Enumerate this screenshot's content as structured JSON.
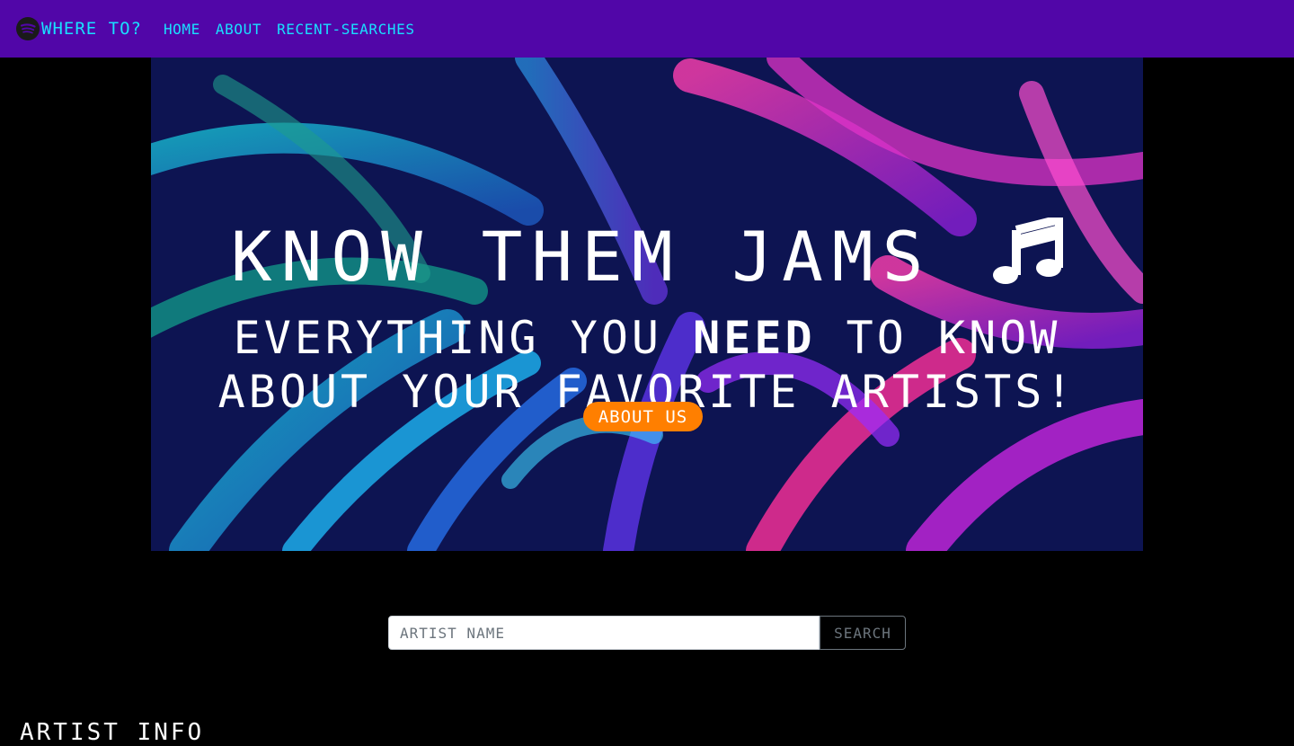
{
  "nav": {
    "brand": "WHERE TO?",
    "links": [
      "HOME",
      "ABOUT",
      "RECENT-SEARCHES"
    ]
  },
  "hero": {
    "title": "KNOW THEM JAMS",
    "subtitle_line1_a": "EVERYTHING YOU ",
    "subtitle_line1_bold": "NEED",
    "subtitle_line1_b": " TO KNOW",
    "subtitle_line2": "ABOUT YOUR FAVORITE ARTISTS!",
    "button": "ABOUT US"
  },
  "search": {
    "placeholder": "ARTIST NAME",
    "button": "SEARCH"
  },
  "section": {
    "title": "ARTIST INFO"
  },
  "colors": {
    "navbar": "#5106a8",
    "nav_text": "#19e0ff",
    "accent_button": "#ff7f00",
    "background": "#000000"
  },
  "icons": {
    "brand": "spotify-icon",
    "title": "music-note-icon"
  }
}
